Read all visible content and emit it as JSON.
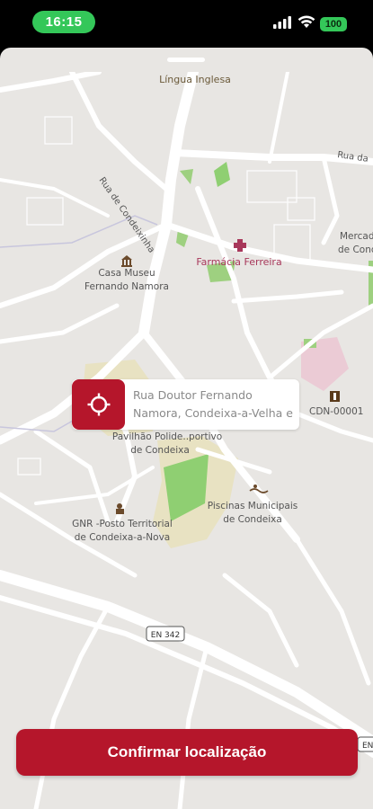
{
  "status": {
    "time": "16:15",
    "battery": "100"
  },
  "map": {
    "labels": {
      "lingua": "Língua Inglesa",
      "rua_condeixinha": "Rua de Condeixinha",
      "rua_da": "Rua da",
      "mercado_1": "Mercad",
      "mercado_2": "de Condei",
      "farmacia": "Farmácia Ferreira",
      "casa_1": "Casa Museu",
      "casa_2": "Fernando Namora",
      "cdn": "CDN-00001",
      "pavilhao_1": "Pavilhão Polide..portivo",
      "pavilhao_2": "de Condeixa",
      "piscinas_1": "Piscinas Municipais",
      "piscinas_2": "de Condeixa",
      "gnr_1": "GNR -Posto Territorial",
      "gnr_2": "de Condeixa-a-Nova",
      "road_en": "EN 342",
      "road_right": "EN"
    }
  },
  "address": {
    "text": "Rua Doutor Fernando Namora, Condeixa-a-Velha e"
  },
  "confirm": {
    "label": "Confirmar localização"
  },
  "colors": {
    "accent": "#b5162b",
    "status_green": "#34c759"
  }
}
